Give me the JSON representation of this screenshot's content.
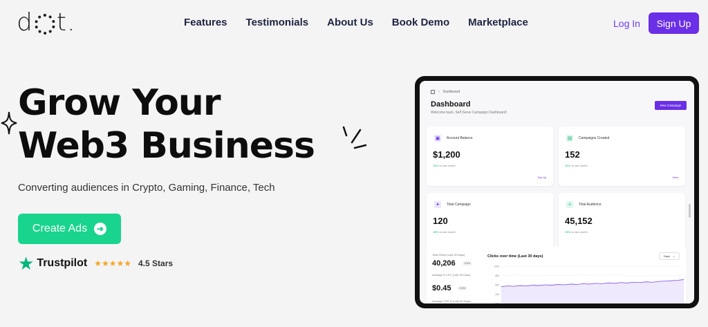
{
  "brand": {
    "logo_left": "d",
    "logo_right": "t."
  },
  "nav": {
    "items": [
      "Features",
      "Testimonials",
      "About Us",
      "Book Demo",
      "Marketplace"
    ]
  },
  "auth": {
    "login": "Log In",
    "signup": "Sign Up"
  },
  "hero": {
    "title_line1": "Grow Your",
    "title_line2": "Web3 Business",
    "subtitle": "Converting audiences in Crypto, Gaming, Finance, Tech",
    "cta": "Create Ads",
    "trust": {
      "brand": "Trustpilot",
      "stars": "★★★★★",
      "rating": "4.5 Stars"
    }
  },
  "dashboard": {
    "breadcrumb": "Dashboard",
    "title": "Dashboard",
    "subtitle": "Welcome back, Self Serve Campaign Dashboard!",
    "new_campaign": "New Campaign",
    "cards": [
      {
        "label": "Account Balance",
        "value": "$1,200",
        "change": "15%",
        "change_suffix": "vs last month",
        "action": "Top Up"
      },
      {
        "label": "Campaigns Created",
        "value": "152",
        "change": "25%",
        "change_suffix": "vs last month",
        "action": "View"
      },
      {
        "label": "Total Campaign",
        "value": "120",
        "change": "18%",
        "change_suffix": "vs last month",
        "action": ""
      },
      {
        "label": "Total Audience",
        "value": "45,152",
        "change": "28%",
        "change_suffix": "vs last month",
        "action": ""
      }
    ],
    "stats": [
      {
        "label": "Total Clicks (Last 30 Days)",
        "value": "40,206",
        "badge": "8.0%"
      },
      {
        "label": "Average E-CPC (Last 30 Days)",
        "value": "$0.45",
        "badge": "0.6%"
      },
      {
        "label": "Average CTR % (Last 30 Days)",
        "value": "",
        "badge": ""
      }
    ],
    "chart_title": "Clicks over time (Last 30 days)",
    "range": "Days"
  },
  "colors": {
    "accent": "#6a2fe6",
    "cta": "#19d48d",
    "trustpilot": "#00b67a"
  },
  "chart_data": {
    "type": "area",
    "title": "Clicks over time (Last 30 days)",
    "yticks": [
      "100k",
      "80k",
      "60k",
      "40k",
      "20k"
    ],
    "ylim": [
      0,
      100
    ],
    "values": [
      45,
      47,
      46,
      48,
      47,
      49,
      48,
      50,
      49,
      51,
      50,
      52,
      51,
      53,
      52,
      54,
      53,
      55,
      54,
      56,
      55,
      57,
      56,
      58,
      57,
      59,
      60,
      61,
      62,
      64
    ]
  }
}
